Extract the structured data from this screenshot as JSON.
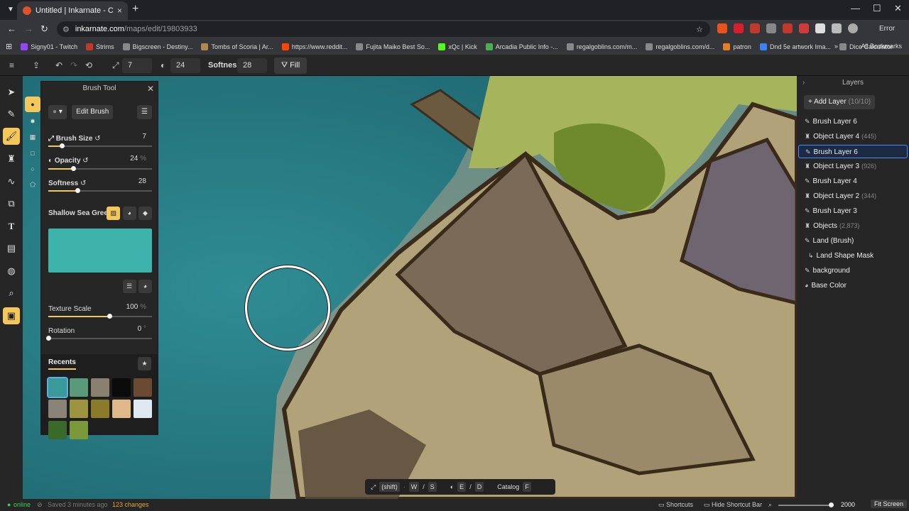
{
  "browser": {
    "tab_title": "Untitled | Inkarnate - Create Fa",
    "tab_close": "×",
    "new_tab": "+",
    "url_host": "inkarnate.com",
    "url_path": "/maps/edit/19803933",
    "profile_label": "Error",
    "bookmarks": [
      {
        "label": "Signy01 - Twitch",
        "color": "#9146ff"
      },
      {
        "label": "Strims",
        "color": "#c0392b"
      },
      {
        "label": "Bigscreen - Destiny...",
        "color": "#888888"
      },
      {
        "label": "Tombs of Scoria | Ar...",
        "color": "#b08850"
      },
      {
        "label": "https://www.reddit...",
        "color": "#ff4500"
      },
      {
        "label": "Fujita Maiko Best So...",
        "color": "#888888"
      },
      {
        "label": "xQc | Kick",
        "color": "#53fc18"
      },
      {
        "label": "Arcadia Public Info -...",
        "color": "#4caf50"
      },
      {
        "label": "regalgoblins.com/m...",
        "color": "#888888"
      },
      {
        "label": "regalgoblins.com/d...",
        "color": "#888888"
      },
      {
        "label": "patron",
        "color": "#e67e22"
      },
      {
        "label": "Dnd 5e artwork Ima...",
        "color": "#3b82f6"
      },
      {
        "label": "Dice Calculator",
        "color": "#888888"
      }
    ],
    "all_bookmarks": "All Bookmarks"
  },
  "toolbar": {
    "brush_size": "7",
    "opacity": "24",
    "softness_label": "Softness:",
    "softness": "28",
    "fill_label": "Fill"
  },
  "brush_panel": {
    "title": "Brush Tool",
    "edit_brush": "Edit Brush",
    "brush_size_label": "Brush Size",
    "brush_size_value": "7",
    "brush_size_level": 0.13,
    "opacity_label": "Opacity",
    "opacity_value": "24",
    "opacity_unit": "%",
    "opacity_level": 0.24,
    "softness_label": "Softness",
    "softness_value": "28",
    "softness_level": 0.28,
    "texture_name": "Shallow Sea Green",
    "texture_color": "#3db3ac",
    "texture_scale_label": "Texture Scale",
    "texture_scale_value": "100",
    "texture_scale_unit": "%",
    "texture_scale_level": 0.59,
    "rotation_label": "Rotation",
    "rotation_value": "0",
    "rotation_unit": "°",
    "rotation_level": 0,
    "recents_label": "Recents",
    "recent_colors": [
      "#3a9a9a",
      "#5a9a7a",
      "#8a8070",
      "#0a0a0a",
      "#6b4a34",
      "#8a8478",
      "#9c9440",
      "#8a7a2a",
      "#e0b888",
      "#dde8f0",
      "#3a6a2a",
      "#7a9a3a"
    ]
  },
  "layers": {
    "title": "Layers",
    "add_layer": "Add Layer",
    "add_layer_count": "(10/10)",
    "items": [
      {
        "label": "Brush Layer 6",
        "count": "",
        "icon": "brush-icon"
      },
      {
        "label": "Object Layer 4",
        "count": "(445)",
        "icon": "object-icon"
      },
      {
        "label": "Brush Layer 6",
        "count": "",
        "icon": "brush-icon"
      },
      {
        "label": "Object Layer 3",
        "count": "(926)",
        "icon": "object-icon"
      },
      {
        "label": "Brush Layer 4",
        "count": "",
        "icon": "brush-icon"
      },
      {
        "label": "Object Layer 2",
        "count": "(344)",
        "icon": "object-icon"
      },
      {
        "label": "Brush Layer 3",
        "count": "",
        "icon": "brush-icon"
      },
      {
        "label": "Objects",
        "count": "(2,873)",
        "icon": "object-icon"
      },
      {
        "label": "Land (Brush)",
        "count": "",
        "icon": "brush-icon"
      },
      {
        "label": "Land Shape Mask",
        "count": "",
        "icon": "mask-icon"
      },
      {
        "label": "background",
        "count": "",
        "icon": "brush-icon"
      },
      {
        "label": "Base Color",
        "count": "",
        "icon": "palette-icon"
      }
    ]
  },
  "shortcut_bar": {
    "shift": "(shift)",
    "w": "W",
    "slash1": "/",
    "s": "S",
    "e": "E",
    "slash2": "/",
    "d": "D",
    "catalog": "Catalog",
    "f": "F"
  },
  "status": {
    "online": "online",
    "saved": "Saved 3 minutes ago",
    "changes": "123 changes",
    "shortcuts": "Shortcuts",
    "hide_shortcut_bar": "Hide Shortcut Bar",
    "zoom": "2000",
    "fit_screen": "Fit Screen"
  }
}
